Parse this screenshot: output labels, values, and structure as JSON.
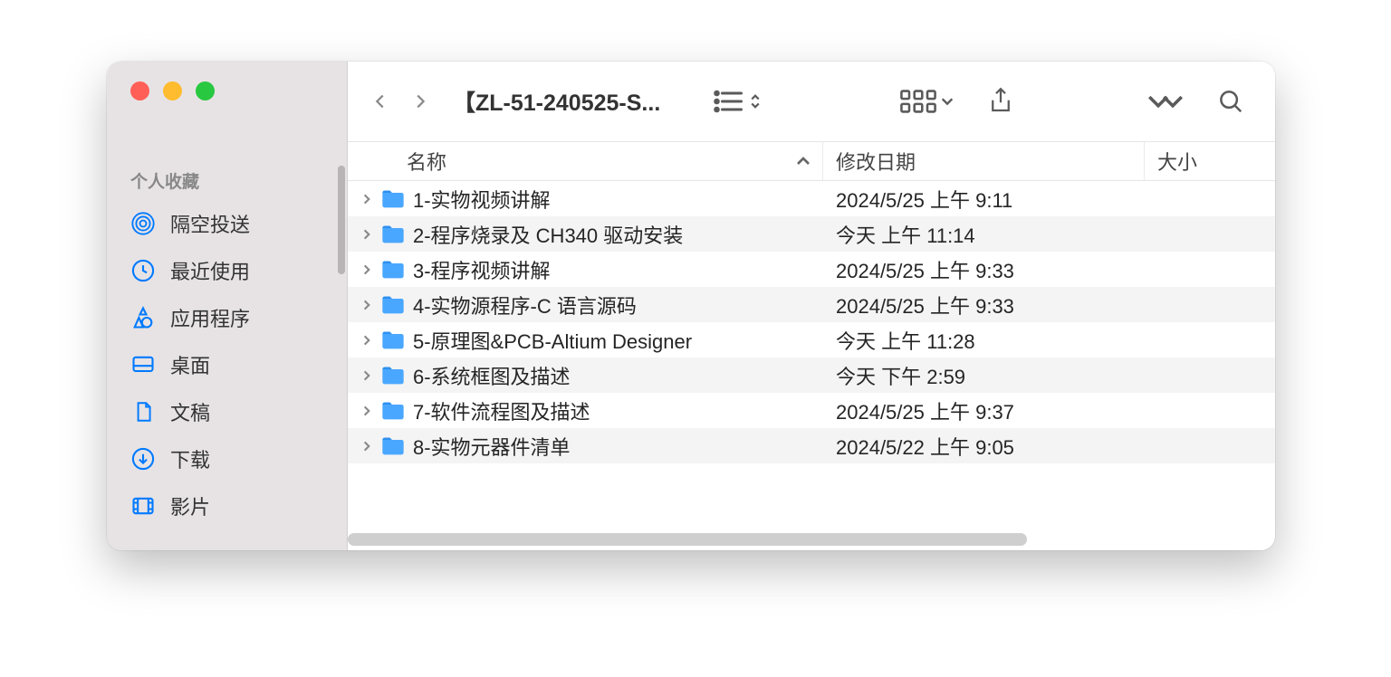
{
  "window": {
    "title": "【ZL-51-240525-S..."
  },
  "sidebar": {
    "section_title": "个人收藏",
    "items": [
      {
        "label": "隔空投送"
      },
      {
        "label": "最近使用"
      },
      {
        "label": "应用程序"
      },
      {
        "label": "桌面"
      },
      {
        "label": "文稿"
      },
      {
        "label": "下载"
      },
      {
        "label": "影片"
      }
    ]
  },
  "columns": {
    "name": "名称",
    "date": "修改日期",
    "size": "大小"
  },
  "files": [
    {
      "name": "1-实物视频讲解",
      "date": "2024/5/25 上午 9:11",
      "size": ""
    },
    {
      "name": "2-程序烧录及 CH340 驱动安装",
      "date": "今天 上午 11:14",
      "size": ""
    },
    {
      "name": "3-程序视频讲解",
      "date": "2024/5/25 上午 9:33",
      "size": ""
    },
    {
      "name": "4-实物源程序-C 语言源码",
      "date": "2024/5/25 上午 9:33",
      "size": ""
    },
    {
      "name": "5-原理图&PCB-Altium Designer",
      "date": "今天 上午 11:28",
      "size": ""
    },
    {
      "name": "6-系统框图及描述",
      "date": "今天 下午 2:59",
      "size": ""
    },
    {
      "name": "7-软件流程图及描述",
      "date": "2024/5/25 上午 9:37",
      "size": ""
    },
    {
      "name": "8-实物元器件清单",
      "date": "2024/5/22 上午 9:05",
      "size": ""
    }
  ]
}
